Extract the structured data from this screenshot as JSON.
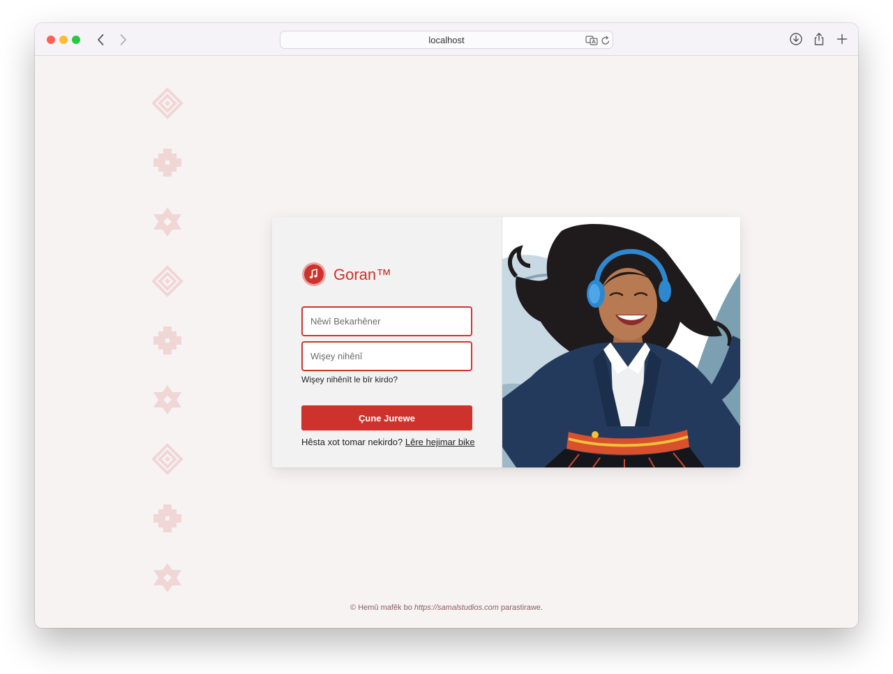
{
  "browser": {
    "address": "localhost"
  },
  "brand": {
    "name": "Goran™"
  },
  "login": {
    "username_placeholder": "Nêwî Bekarhêner",
    "password_placeholder": "Wişey nihênî",
    "forgot_label": "Wişey nihênît le bîr kirdo?",
    "submit_label": "Çune Jurewe",
    "signup_prompt": "Hêsta xot tomar nekirdo?",
    "signup_link": "Lêre hejimar bike"
  },
  "footer": {
    "prefix": "© Hemû mafêk bo",
    "site": "https://samalstudios.com",
    "suffix": "parastirawe."
  },
  "colors": {
    "brand_red": "#cd322d",
    "motif_pink": "#f1d6d6",
    "page_bg": "#f6f3f2"
  },
  "icons": [
    "back-arrow-icon",
    "forward-arrow-icon",
    "translate-icon",
    "reload-icon",
    "download-icon",
    "share-icon",
    "plus-icon",
    "music-note-icon"
  ]
}
